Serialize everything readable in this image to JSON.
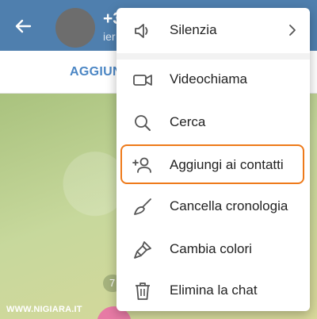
{
  "header": {
    "title": "+3",
    "subtitle": "ier",
    "back_icon": "arrow-left-icon",
    "colors": {
      "background": "#4f7fae",
      "text": "#ffffff"
    }
  },
  "tabbar": {
    "add_label": "AGGIUNG"
  },
  "chat": {
    "date_pill": "7",
    "watermark": "WWW.NIGIARA.IT"
  },
  "menu": {
    "items": [
      {
        "label": "Silenzia",
        "icon": "speaker-icon",
        "has_submenu": true
      },
      {
        "label": "Videochiama",
        "icon": "video-camera-icon"
      },
      {
        "label": "Cerca",
        "icon": "search-icon"
      },
      {
        "label": "Aggiungi ai contatti",
        "icon": "add-contact-icon",
        "highlighted": true
      },
      {
        "label": "Cancella cronologia",
        "icon": "broom-icon"
      },
      {
        "label": "Cambia colori",
        "icon": "brush-icon"
      },
      {
        "label": "Elimina la chat",
        "icon": "trash-icon"
      }
    ],
    "highlight_color": "#ee7a1a"
  }
}
